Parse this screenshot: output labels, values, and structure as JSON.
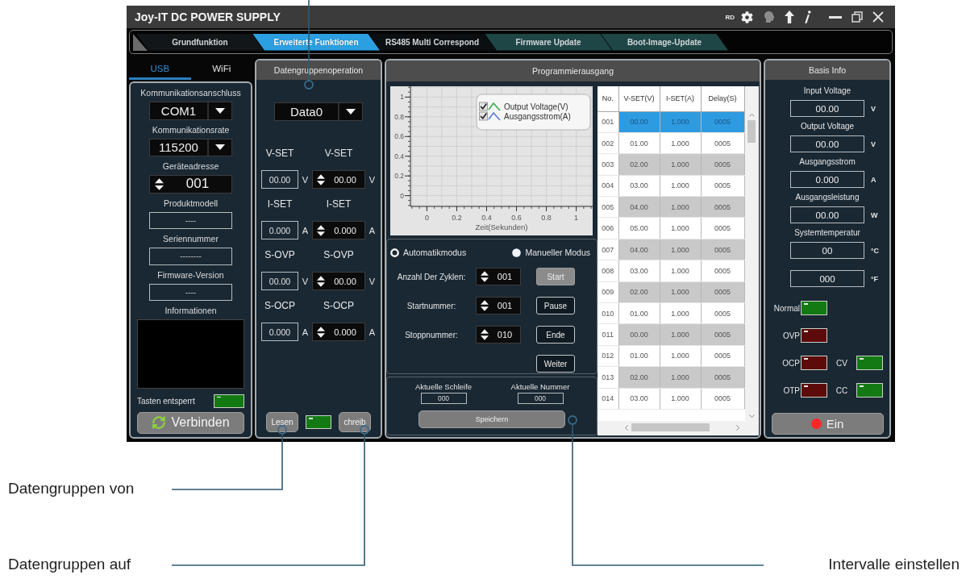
{
  "window": {
    "title": "Joy-IT DC POWER SUPPLY",
    "badge": "RD"
  },
  "tabs": [
    {
      "label": "Grundfunktion",
      "selected": false,
      "color": "#121618"
    },
    {
      "label": "Erweiterte Funktionen",
      "selected": true,
      "color": "#2c9fe0"
    },
    {
      "label": "RS485 Multi Correspond",
      "selected": false,
      "color": "#0c0f11"
    },
    {
      "label": "Firmware Update",
      "selected": false,
      "color": "#1e4647"
    },
    {
      "label": "Boot-Image-Update",
      "selected": false,
      "color": "#1e4647"
    }
  ],
  "connection": {
    "tabs": [
      {
        "label": "USB",
        "selected": true
      },
      {
        "label": "WiFi",
        "selected": false
      }
    ],
    "fields": [
      {
        "kind": "dropdown",
        "label": "Kommunikationsanschluss",
        "value": "COM1"
      },
      {
        "kind": "dropdown",
        "label": "Kommunikationsrate",
        "value": "115200"
      },
      {
        "kind": "spinner",
        "label": "Geräteadresse",
        "value": "001"
      },
      {
        "kind": "readout",
        "label": "Produktmodell",
        "value": "----"
      },
      {
        "kind": "readout",
        "label": "Seriennummer",
        "value": "--------"
      },
      {
        "kind": "readout",
        "label": "Firmware-Version",
        "value": "----"
      },
      {
        "kind": "log",
        "label": "Informationen"
      }
    ],
    "unlock": {
      "label": "Tasten entsperrt",
      "on": true
    },
    "connect_button": "Verbinden"
  },
  "data_groups": {
    "title": "Datengruppenoperation",
    "group": "Data0",
    "params": [
      {
        "label": "V-SET",
        "value": "00.00",
        "unit": "V",
        "set_label": "V-SET",
        "set_value": "00.00",
        "set_unit": "V"
      },
      {
        "label": "I-SET",
        "value": "0.000",
        "unit": "A",
        "set_label": "I-SET",
        "set_value": "0.000",
        "set_unit": "A"
      },
      {
        "label": "S-OVP",
        "value": "00.00",
        "unit": "V",
        "set_label": "S-OVP",
        "set_value": "00.00",
        "set_unit": "V"
      },
      {
        "label": "S-OCP",
        "value": "0.000",
        "unit": "A",
        "set_label": "S-OCP",
        "set_value": "0.000",
        "set_unit": "A"
      }
    ],
    "read_button": "Lesen",
    "status": {
      "on": true
    },
    "write_button": "chreib"
  },
  "program": {
    "title": "Programmierausgang",
    "chart": {
      "y_ticks": [
        "1",
        "0.8",
        "0.6",
        "0.4",
        "0.2",
        "0"
      ],
      "x_ticks": [
        "0",
        "0.2",
        "0.4",
        "0.6",
        "0.8",
        "1"
      ],
      "x_title": "Zeit(Sekunden)",
      "legend": [
        {
          "label": "Output Voltage(V)",
          "color": "#3cae4a",
          "checked": true
        },
        {
          "label": "Ausgangsstrom(A)",
          "color": "#5b7bd5",
          "checked": true
        }
      ]
    },
    "modes": [
      {
        "label": "Automatikmodus",
        "selected": true
      },
      {
        "label": "Manueller Modus",
        "selected": false
      }
    ],
    "counters": [
      {
        "label": "Anzahl Der Zyklen:",
        "value": "001"
      },
      {
        "label": "Startnummer:",
        "value": "001"
      },
      {
        "label": "Stoppnummer:",
        "value": "010"
      }
    ],
    "buttons": [
      {
        "label": "Start",
        "kind": "filled"
      },
      {
        "label": "Pause",
        "kind": "outlined"
      },
      {
        "label": "Ende",
        "kind": "outlined"
      },
      {
        "label": "Weiter",
        "kind": "outlined"
      }
    ],
    "current": [
      {
        "label": "Aktuelle Schleife",
        "value": "000"
      },
      {
        "label": "Aktuelle Nummer",
        "value": "000"
      }
    ],
    "save_button": "Speichern",
    "table": {
      "columns": [
        "No.",
        "V-SET(V)",
        "I-SET(A)",
        "Delay(S)"
      ],
      "rows": [
        {
          "cells": [
            "001",
            "00.00",
            "1.000",
            "0005"
          ],
          "selected": true
        },
        {
          "cells": [
            "002",
            "01.00",
            "1.000",
            "0005"
          ],
          "selected": false
        },
        {
          "cells": [
            "003",
            "02.00",
            "1.000",
            "0005"
          ],
          "selected": false
        },
        {
          "cells": [
            "004",
            "03.00",
            "1.000",
            "0005"
          ],
          "selected": false
        },
        {
          "cells": [
            "005",
            "04.00",
            "1.000",
            "0005"
          ],
          "selected": false
        },
        {
          "cells": [
            "006",
            "05.00",
            "1.000",
            "0005"
          ],
          "selected": false
        },
        {
          "cells": [
            "007",
            "04.00",
            "1.000",
            "0005"
          ],
          "selected": false
        },
        {
          "cells": [
            "008",
            "03.00",
            "1.000",
            "0005"
          ],
          "selected": false
        },
        {
          "cells": [
            "009",
            "02.00",
            "1.000",
            "0005"
          ],
          "selected": false
        },
        {
          "cells": [
            "010",
            "01.00",
            "1.000",
            "0005"
          ],
          "selected": false
        },
        {
          "cells": [
            "011",
            "00.00",
            "1.000",
            "0005"
          ],
          "selected": false
        },
        {
          "cells": [
            "012",
            "01.00",
            "1.000",
            "0005"
          ],
          "selected": false
        },
        {
          "cells": [
            "013",
            "02.00",
            "1.000",
            "0005"
          ],
          "selected": false
        },
        {
          "cells": [
            "014",
            "03.00",
            "1.000",
            "0005"
          ],
          "selected": false
        }
      ]
    }
  },
  "basis_info": {
    "title": "Basis Info",
    "readings": [
      {
        "label": "Input Voltage",
        "value": "00.00",
        "unit": "V"
      },
      {
        "label": "Output Voltage",
        "value": "00.00",
        "unit": "V"
      },
      {
        "label": "Ausgangsstrom",
        "value": "0.000",
        "unit": "A"
      },
      {
        "label": "Ausgangsleistung",
        "value": "00.00",
        "unit": "W"
      },
      {
        "label": "Systemtemperatur",
        "value": "00",
        "unit": "°C"
      },
      {
        "value": "000",
        "unit": "°F"
      }
    ],
    "indicator_rows": [
      {
        "items": [
          {
            "label": "Normal",
            "color": "#137a13"
          }
        ]
      },
      {
        "items": [
          {
            "label": "OVP",
            "color": "#5c0a0a"
          }
        ]
      },
      {
        "items": [
          {
            "label": "OCP",
            "color": "#5c0a0a"
          },
          {
            "label": "CV",
            "color": "#137a13"
          }
        ]
      },
      {
        "items": [
          {
            "label": "OTP",
            "color": "#5c0a0a"
          },
          {
            "label": "CC",
            "color": "#137a13"
          }
        ]
      }
    ],
    "power_button": "Ein"
  },
  "callouts": [
    {
      "label": "Datengruppen von"
    },
    {
      "label": "Datengruppen auf"
    },
    {
      "label": "Intervalle einstellen"
    }
  ]
}
